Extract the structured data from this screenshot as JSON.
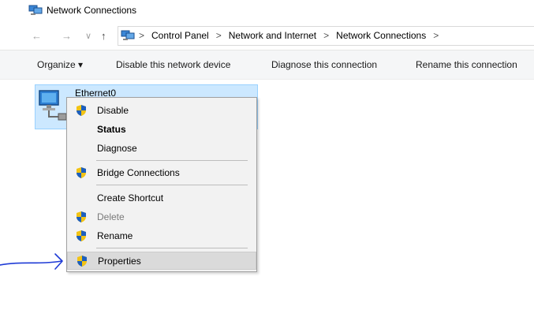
{
  "window": {
    "title": "Network Connections"
  },
  "nav": {
    "back": "←",
    "forward": "→",
    "recent": "∨",
    "up": "↑",
    "sep": ">",
    "breadcrumbs": [
      "Control Panel",
      "Network and Internet",
      "Network Connections"
    ]
  },
  "toolbar": {
    "organize": "Organize ▾",
    "disable": "Disable this network device",
    "diagnose": "Diagnose this connection",
    "rename": "Rename this connection"
  },
  "item": {
    "name": "Ethernet0"
  },
  "menu": {
    "items": [
      {
        "label": "Disable",
        "shield": true
      },
      {
        "label": "Status",
        "bold": true
      },
      {
        "label": "Diagnose"
      },
      {
        "label": "Bridge Connections",
        "shield": true
      },
      {
        "label": "Create Shortcut"
      },
      {
        "label": "Delete",
        "shield": true,
        "disabled": true
      },
      {
        "label": "Rename",
        "shield": true
      },
      {
        "label": "Properties",
        "shield": true,
        "highlighted": true
      }
    ]
  },
  "colors": {
    "selection": "#cce8ff",
    "annotation": "#1f3bd6",
    "shield_blue": "#1c5fbf",
    "shield_yellow": "#f2c314"
  }
}
